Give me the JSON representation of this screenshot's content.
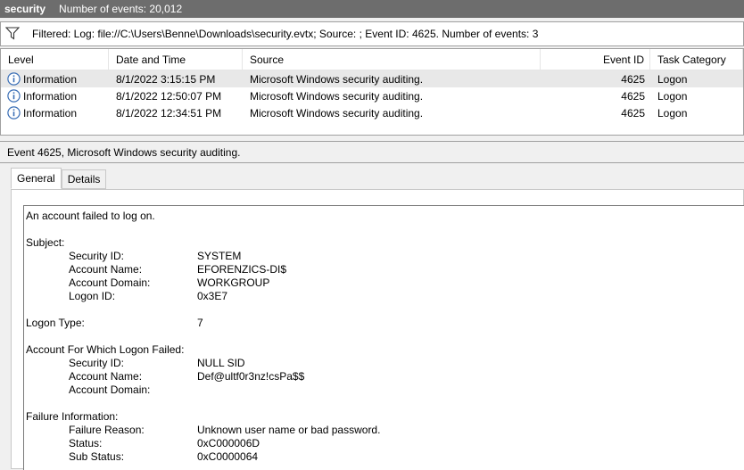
{
  "title": {
    "name": "security",
    "count": "Number of events: 20,012"
  },
  "filter": {
    "text": "Filtered: Log: file://C:\\Users\\Benne\\Downloads\\security.evtx; Source: ; Event ID: 4625. Number of events: 3"
  },
  "columns": {
    "level": "Level",
    "date": "Date and Time",
    "source": "Source",
    "id": "Event ID",
    "task": "Task Category"
  },
  "rows": [
    {
      "level": "Information",
      "date": "8/1/2022 3:15:15 PM",
      "source": "Microsoft Windows security auditing.",
      "id": "4625",
      "task": "Logon"
    },
    {
      "level": "Information",
      "date": "8/1/2022 12:50:07 PM",
      "source": "Microsoft Windows security auditing.",
      "id": "4625",
      "task": "Logon"
    },
    {
      "level": "Information",
      "date": "8/1/2022 12:34:51 PM",
      "source": "Microsoft Windows security auditing.",
      "id": "4625",
      "task": "Logon"
    }
  ],
  "detail": {
    "header": "Event 4625, Microsoft Windows security auditing.",
    "tabs": {
      "general": "General",
      "details": "Details"
    },
    "message": {
      "intro": "An account failed to log on.",
      "subject": {
        "heading": "Subject:",
        "security_id_k": "Security ID:",
        "security_id_v": "SYSTEM",
        "account_name_k": "Account Name:",
        "account_name_v": "EFORENZICS-DI$",
        "account_domain_k": "Account Domain:",
        "account_domain_v": "WORKGROUP",
        "logon_id_k": "Logon ID:",
        "logon_id_v": "0x3E7"
      },
      "logon_type": {
        "k": "Logon Type:",
        "v": "7"
      },
      "failed": {
        "heading": "Account For Which Logon Failed:",
        "security_id_k": "Security ID:",
        "security_id_v": "NULL SID",
        "account_name_k": "Account Name:",
        "account_name_v": "Def@ultf0r3nz!csPa$$",
        "account_domain_k": "Account Domain:",
        "account_domain_v": ""
      },
      "failure": {
        "heading": "Failure Information:",
        "reason_k": "Failure Reason:",
        "reason_v": "Unknown user name or bad password.",
        "status_k": "Status:",
        "status_v": "0xC000006D",
        "substatus_k": "Sub Status:",
        "substatus_v": "0xC0000064"
      }
    }
  },
  "icons": {
    "filter": "funnel-icon",
    "level": "information-icon"
  },
  "colors": {
    "titlebar": "#6d6d6d",
    "selected_row": "#e8e8e8",
    "info_icon": "#3b6fb6"
  }
}
